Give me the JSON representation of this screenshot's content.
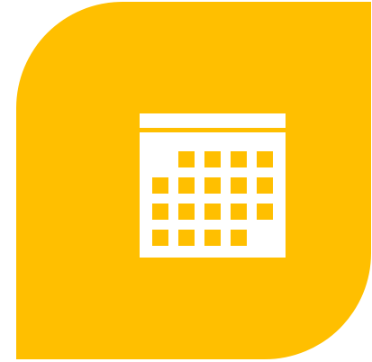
{
  "icon": {
    "name": "calendar-icon",
    "accent_color": "#ffbf00",
    "glyph_color": "#ffffff",
    "grid": {
      "columns": 5,
      "rows": 4,
      "leading_empty_cells": 1,
      "filled_days": 18
    }
  }
}
